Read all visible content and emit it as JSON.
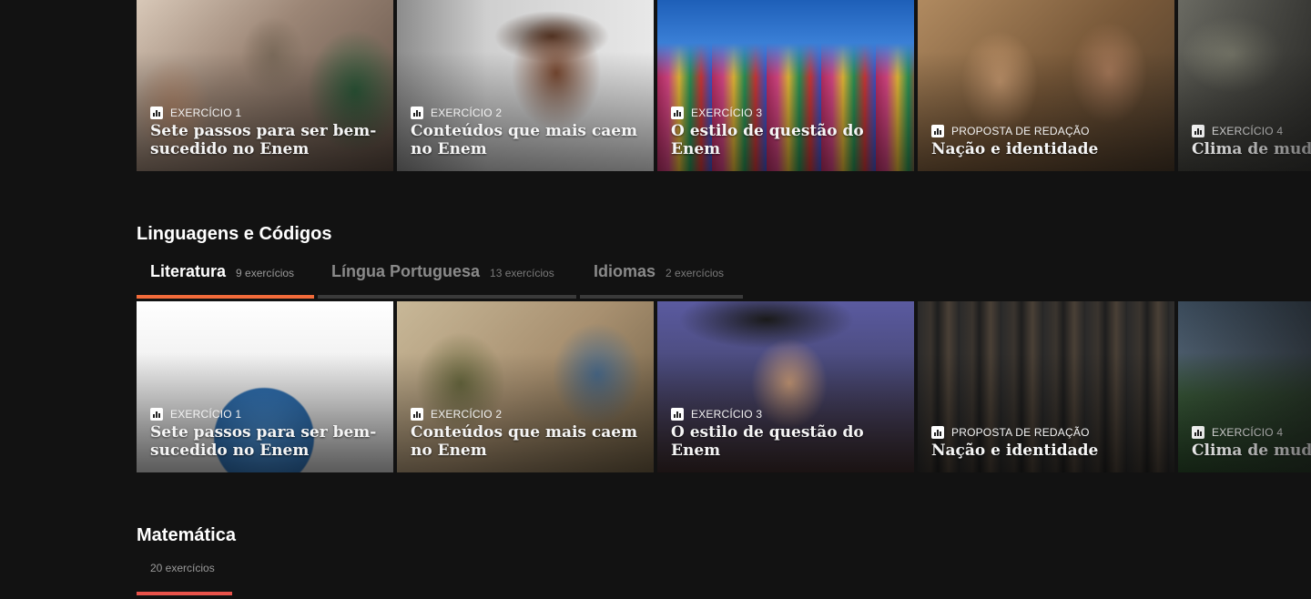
{
  "top_row": [
    {
      "kind": "EXERCÍCIO 1",
      "title": "Sete passos para ser bem-sucedido no Enem",
      "image": "students-studying"
    },
    {
      "kind": "EXERCÍCIO 2",
      "title": "Conteúdos que mais caem no Enem",
      "image": "smiling-girl"
    },
    {
      "kind": "EXERCÍCIO 3",
      "title": "O estilo de questão do Enem",
      "image": "city-street-signs"
    },
    {
      "kind": "PROPOSTA DE REDAÇÃO",
      "title": "Nação e identidade",
      "image": "couple-reading"
    },
    {
      "kind": "EXERCÍCIO 4",
      "title": "Clima de muda",
      "image": "clouds"
    }
  ],
  "linguagens": {
    "title": "Linguagens e Códigos",
    "tabs": [
      {
        "label": "Literatura",
        "count": "9 exercícios",
        "active": true
      },
      {
        "label": "Língua Portuguesa",
        "count": "13 exercícios",
        "active": false
      },
      {
        "label": "Idiomas",
        "count": "2 exercícios",
        "active": false
      }
    ],
    "cards": [
      {
        "kind": "EXERCÍCIO 1",
        "title": "Sete passos para ser bem-sucedido no Enem",
        "image": "globe-people"
      },
      {
        "kind": "EXERCÍCIO 2",
        "title": "Conteúdos que mais caem no Enem",
        "image": "knights"
      },
      {
        "kind": "EXERCÍCIO 3",
        "title": "O estilo de questão do Enem",
        "image": "king-portrait"
      },
      {
        "kind": "PROPOSTA DE REDAÇÃO",
        "title": "Nação e identidade",
        "image": "books"
      },
      {
        "kind": "EXERCÍCIO 4",
        "title": "Clima de muda",
        "image": "field"
      }
    ]
  },
  "matematica": {
    "title": "Matemática",
    "count": "20 exercícios"
  },
  "colors": {
    "background": "#121212",
    "active_tab": "#f26b3a",
    "inactive_tab": "#3a3a3a",
    "matematica_accent": "#e8524a"
  },
  "icons": {
    "exercise": "bar-chart-icon"
  }
}
